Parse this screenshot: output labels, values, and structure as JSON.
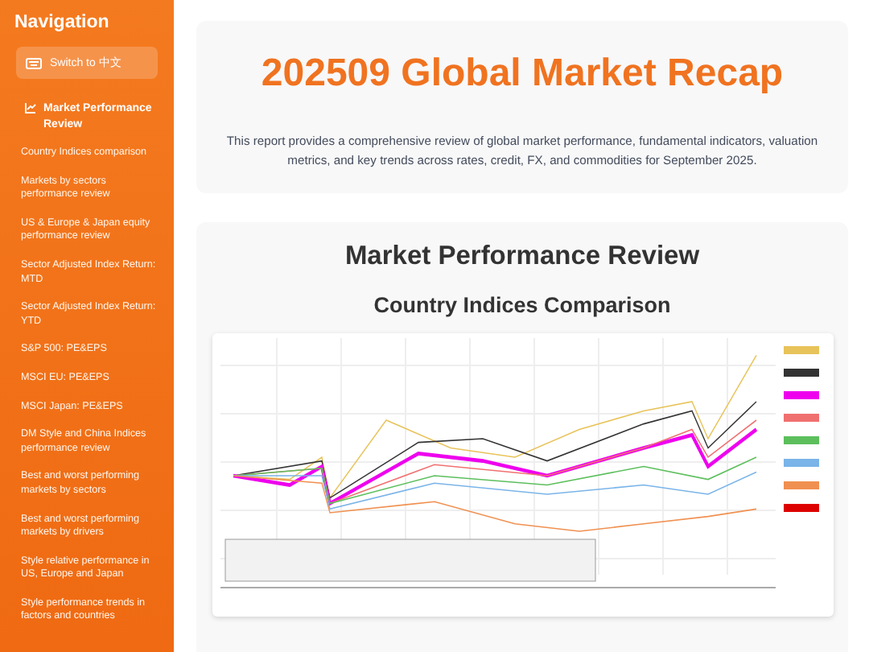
{
  "sidebar": {
    "title": "Navigation",
    "language_button": "Switch to 中文",
    "section": "Market Performance Review",
    "items": [
      "Country Indices comparison",
      "Markets by sectors performance review",
      "US & Europe & Japan equity performance review",
      "Sector Adjusted Index Return: MTD",
      "Sector Adjusted Index Return: YTD",
      "S&P 500: PE&EPS",
      "MSCI EU: PE&EPS",
      "MSCI Japan: PE&EPS",
      "DM Style and China Indices performance review",
      "Best and worst performing markets by sectors",
      "Best and worst performing markets by drivers",
      "Style relative performance in US, Europe and Japan",
      "Style performance trends in factors and countries"
    ]
  },
  "header": {
    "title": "202509 Global Market Recap",
    "description": "This report provides a comprehensive review of global market performance, fundamental indicators, valuation metrics, and key trends across rates, credit, FX, and commodities for September 2025."
  },
  "section": {
    "title": "Market Performance Review",
    "subtitle": "Country Indices Comparison"
  }
}
